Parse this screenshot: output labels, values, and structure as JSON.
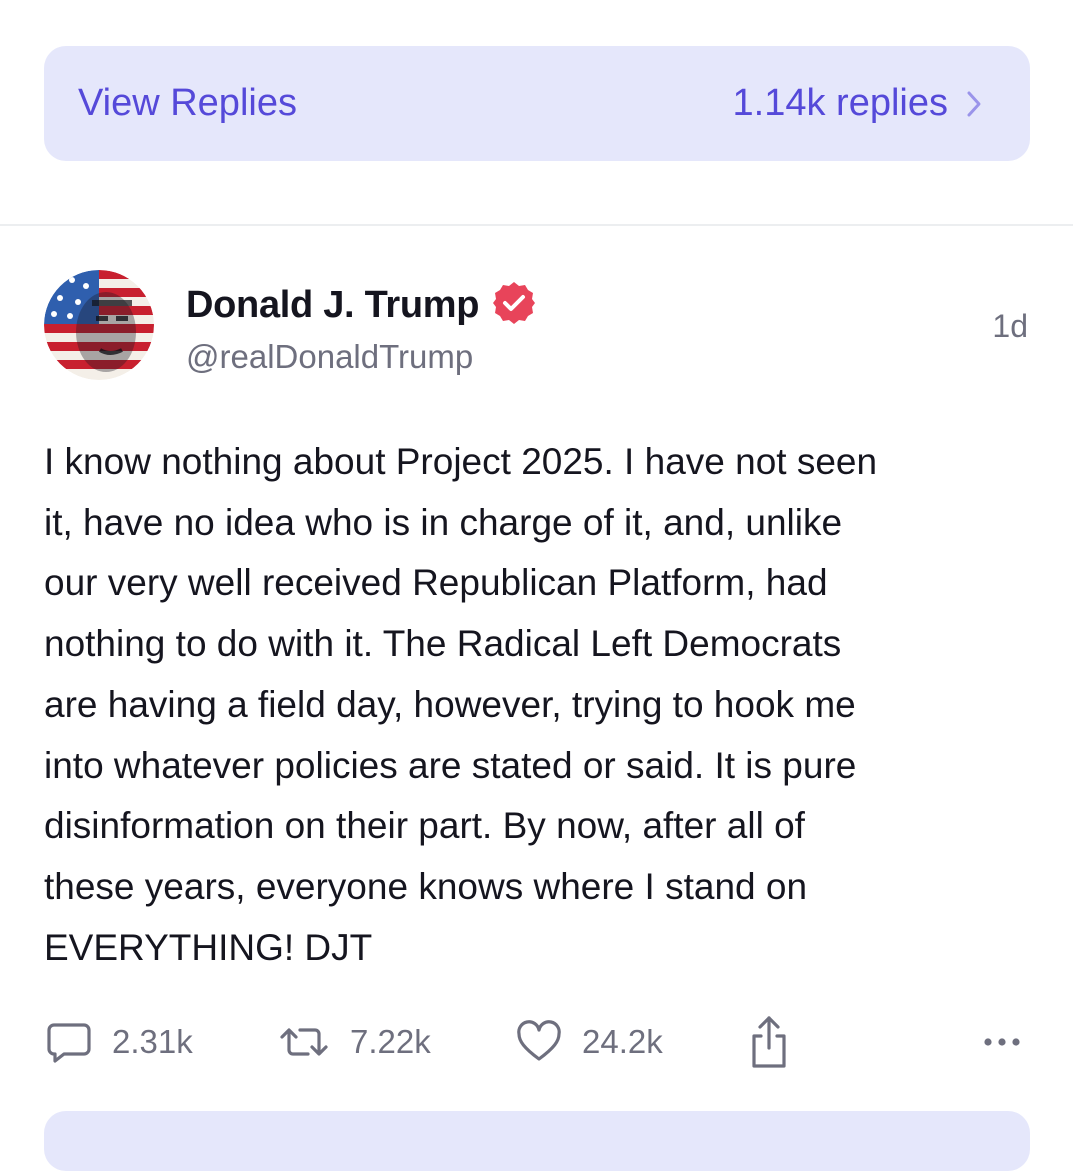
{
  "replies_bar": {
    "label": "View Replies",
    "count": "1.14k replies",
    "chevron_icon": "chevron-right-icon",
    "accent": "#5549d9",
    "background": "#e5e7fb"
  },
  "post": {
    "author": {
      "display_name": "Donald J. Trump",
      "handle": "@realDonaldTrump",
      "verified_icon": "verified-badge-icon",
      "verified_color": "#e8445a"
    },
    "time": "1d",
    "body": "I know nothing about Project 2025. I have not seen\nit, have no idea who is in charge of it, and, unlike\nour very well received Republican Platform, had\nnothing to do with it. The Radical Left Democrats\nare having a field day, however, trying to hook me\ninto whatever policies are stated or said. It is pure\ndisinformation on their part. By now, after all of\nthese years, everyone knows where I stand on\nEVERYTHING! DJT",
    "actions": {
      "replies": "2.31k",
      "retruths": "7.22k",
      "likes": "24.2k"
    }
  }
}
